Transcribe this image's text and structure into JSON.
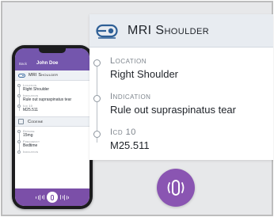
{
  "phone": {
    "back_label": "Back",
    "patient_name": "John Doe",
    "section1_title": "MRI Shoulder",
    "fields": [
      {
        "label": "Location",
        "value": "Right Shoulder"
      },
      {
        "label": "Indication",
        "value": "Rule out supraspinatus tear"
      },
      {
        "label": "Icd 10",
        "value": "M25.511"
      }
    ],
    "section2_title": "Codeine",
    "fields2": [
      {
        "label": "Dosage",
        "value": "15mg"
      },
      {
        "label": "Frequency",
        "value": "Bedtime"
      },
      {
        "label": "Indication",
        "value": ""
      }
    ]
  },
  "card": {
    "title": "MRI Shoulder",
    "icon": "mri-scanner-icon",
    "fields": [
      {
        "label": "Location",
        "value": "Right Shoulder"
      },
      {
        "label": "Indication",
        "value": "Rule out supraspinatus tear"
      },
      {
        "label": "Icd 10",
        "value": "M25.511"
      }
    ]
  },
  "app_button": {
    "icon": "app-logo-icon"
  },
  "colors": {
    "brand_purple": "#8a55b2",
    "header_bg": "#e8ecf1",
    "icon_blue": "#2e5f96",
    "background": "#e7e8ea"
  }
}
